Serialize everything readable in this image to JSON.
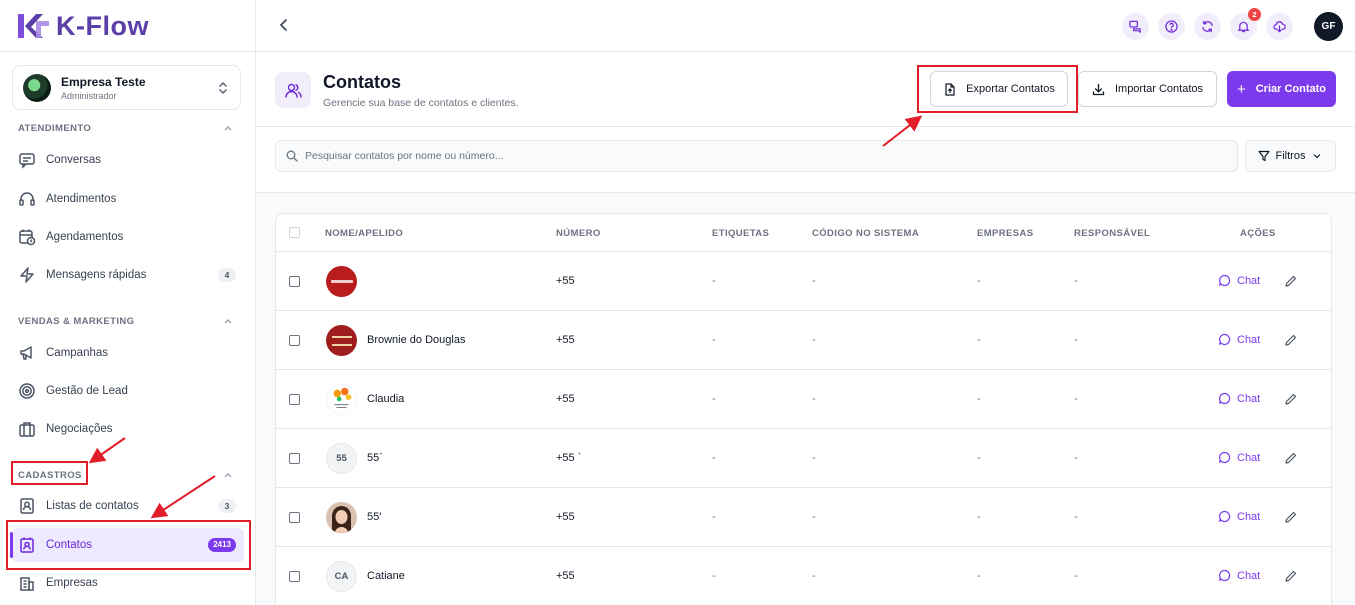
{
  "brand": {
    "name": "K-Flow",
    "color": "#5b3ea8"
  },
  "company": {
    "name": "Empresa Teste",
    "role": "Administrador"
  },
  "sidebar": {
    "sections": [
      {
        "title": "ATENDIMENTO"
      },
      {
        "title": "VENDAS & MARKETING"
      },
      {
        "title": "CADASTROS"
      }
    ],
    "items": [
      {
        "label": "Conversas",
        "icon": "chat-lines-icon"
      },
      {
        "label": "Atendimentos",
        "icon": "headset-icon"
      },
      {
        "label": "Agendamentos",
        "icon": "calendar-clock-icon"
      },
      {
        "label": "Mensagens rápidas",
        "icon": "lightning-icon",
        "count": "4"
      },
      {
        "label": "Campanhas",
        "icon": "megaphone-icon"
      },
      {
        "label": "Gestão de Lead",
        "icon": "target-icon"
      },
      {
        "label": "Negociações",
        "icon": "briefcase-icon"
      },
      {
        "label": "Listas de contatos",
        "icon": "contact-list-icon",
        "count": "3"
      },
      {
        "label": "Contatos",
        "icon": "contact-card-icon",
        "count": "2413",
        "active": true
      },
      {
        "label": "Empresas",
        "icon": "building-icon"
      }
    ]
  },
  "topbar": {
    "notifications_count": "2",
    "user_initials": "GF"
  },
  "header": {
    "title": "Contatos",
    "subtitle": "Gerencie sua base de contatos e clientes.",
    "export_label": "Exportar Contatos",
    "import_label": "Importar Contatos",
    "create_label": "Criar Contato"
  },
  "search": {
    "placeholder": "Pesquisar contatos por nome ou número...",
    "filters_label": "Filtros"
  },
  "table": {
    "columns": [
      "NOME/APELIDO",
      "NÚMERO",
      "ETIQUETAS",
      "CÓDIGO NO SISTEMA",
      "EMPRESAS",
      "RESPONSÁVEL",
      "AÇÕES"
    ],
    "rows": [
      {
        "name": "",
        "number": "+55",
        "tags": "-",
        "code": "-",
        "companies": "-",
        "owner": "-",
        "avatar": "red-logo-image",
        "initials": ""
      },
      {
        "name": "Brownie do Douglas",
        "number": "+55",
        "tags": "-",
        "code": "-",
        "companies": "-",
        "owner": "-",
        "avatar": "brownie-logo-image",
        "initials": ""
      },
      {
        "name": "Claudia",
        "number": "+55",
        "tags": "-",
        "code": "-",
        "companies": "-",
        "owner": "-",
        "avatar": "flowers-image",
        "initials": ""
      },
      {
        "name": "55`",
        "number": "+55 `",
        "tags": "-",
        "code": "-",
        "companies": "-",
        "owner": "-",
        "avatar": "initials",
        "initials": "55"
      },
      {
        "name": "55′",
        "number": "+55",
        "tags": "-",
        "code": "-",
        "companies": "-",
        "owner": "-",
        "avatar": "person-photo-image",
        "initials": ""
      },
      {
        "name": "Catiane",
        "number": "+55",
        "tags": "-",
        "code": "-",
        "companies": "-",
        "owner": "-",
        "avatar": "initials",
        "initials": "CA"
      }
    ],
    "chat_label": "Chat"
  },
  "colors": {
    "accent": "#7c3aed",
    "highlight": "#e11d2a"
  }
}
